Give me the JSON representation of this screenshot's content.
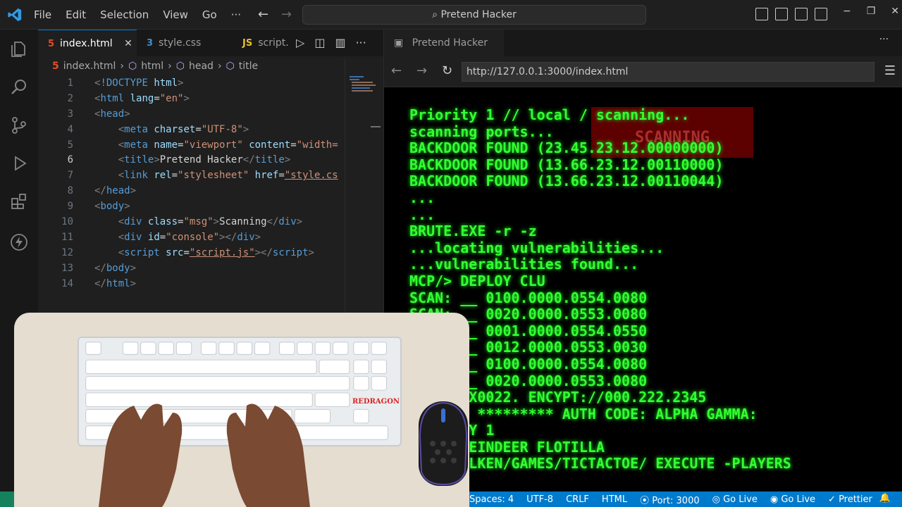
{
  "titlebar": {
    "menu": [
      "File",
      "Edit",
      "Selection",
      "View",
      "Go",
      "···"
    ],
    "search": "Pretend Hacker",
    "back_glyph": "←",
    "forward_glyph": "→"
  },
  "editor": {
    "tabs": [
      {
        "label": "index.html",
        "icon": "html-file-icon",
        "active": true
      },
      {
        "label": "style.css",
        "icon": "css-file-icon",
        "active": false
      },
      {
        "label": "script.",
        "icon": "js-file-icon",
        "active": false
      }
    ],
    "tab_icon_glyphs": {
      "html": "5",
      "css": "3",
      "js": "JS"
    },
    "breadcrumb": [
      "index.html",
      "html",
      "head",
      "title"
    ],
    "line_numbers": [
      "1",
      "2",
      "3",
      "4",
      "5",
      "6",
      "7",
      "8",
      "9",
      "10",
      "11",
      "12",
      "13",
      "14"
    ],
    "current_line": "6"
  },
  "preview": {
    "tab_title": "Pretend Hacker",
    "url": "http://127.0.0.1:3000/index.html",
    "msg": "SCANNING",
    "console_lines": [
      "Priority 1 // local / scanning...",
      "scanning ports...",
      "BACKDOOR FOUND (23.45.23.12.00000000)",
      "BACKDOOR FOUND (13.66.23.12.00110000)",
      "BACKDOOR FOUND (13.66.23.12.00110044)",
      "...",
      "...",
      "BRUTE.EXE -r -z",
      "...locating vulnerabilities...",
      "...vulnerabilities found...",
      "MCP/> DEPLOY CLU",
      "SCAN: __ 0100.0000.0554.0080",
      "SCAN: __ 0020.0000.0553.0080",
      "SCAN: __ 0001.0000.0554.0550",
      "SCAN: __ 0012.0000.0553.0030",
      "SCAN: __ 0100.0000.0554.0080",
      "SCAN: __ 0020.0000.0553.0080",
      "SCAN: XX0022. ENCYPT://000.222.2345",
      "ACCESS: ********* AUTH CODE: ALPHA GAMMA:",
      "PRIORITY 1",
      "ROUTE REINDEER FLOTILLA",
      "FAUX/FALKEN/GAMES/TICTACTOE/ EXECUTE -PLAYERS"
    ]
  },
  "statusbar": {
    "items": [
      "Spaces: 4",
      "UTF-8",
      "CRLF",
      "HTML",
      "Port: 3000",
      "Go Live",
      "Go Live",
      "Prettier"
    ]
  },
  "overlay": {
    "brand": "REDRAGON"
  },
  "colors": {
    "accent": "#007acc",
    "terminal_green": "#33ff33",
    "msg_red": "#aa0000"
  }
}
